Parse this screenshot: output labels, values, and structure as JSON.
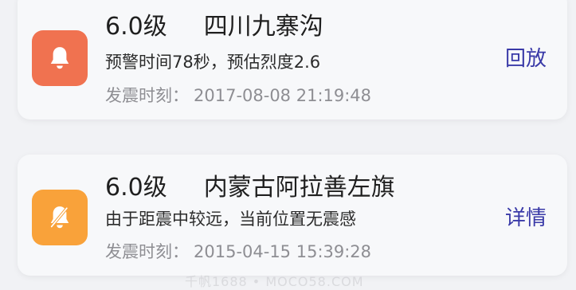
{
  "colors": {
    "alert_icon_red": "#f07250",
    "alert_icon_amber": "#f9a23a",
    "action_text": "#3a3aa8",
    "time_text": "#8e8e93"
  },
  "events": [
    {
      "magnitude": "6.0级",
      "location": "四川九寨沟",
      "description": "预警时间78秒，预估烈度2.6",
      "time_label": "发震时刻：",
      "time_value": "2017-08-08 21:19:48",
      "action_label": "回放",
      "icon": "bell-icon"
    },
    {
      "magnitude": "6.0级",
      "location": "内蒙古阿拉善左旗",
      "description": "由于距震中较远，当前位置无震感",
      "time_label": "发震时刻：",
      "time_value": "2015-04-15 15:39:28",
      "action_label": "详情",
      "icon": "bell-off-icon"
    }
  ],
  "watermark": "千帆1688 • MOCO58.COM"
}
